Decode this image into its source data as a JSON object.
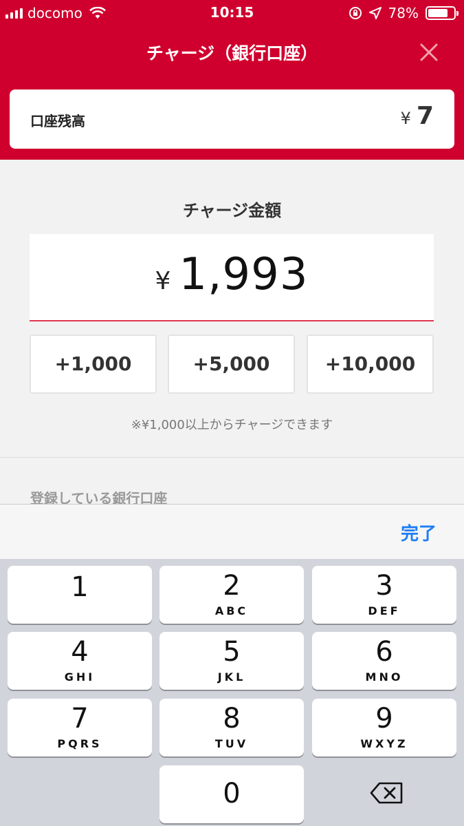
{
  "status_bar": {
    "carrier": "docomo",
    "time": "10:15",
    "battery": "78%",
    "battery_level": 0.78
  },
  "header": {
    "title": "チャージ（銀行口座）",
    "close_icon": "close-icon"
  },
  "balance": {
    "label": "口座残高",
    "currency": "¥",
    "value": "7"
  },
  "charge": {
    "title": "チャージ金額",
    "currency": "¥",
    "amount": "1,993",
    "quick_buttons": [
      "+1,000",
      "+5,000",
      "+10,000"
    ],
    "note": "※¥1,000以上からチャージできます"
  },
  "bank_section": {
    "label": "登録している銀行口座"
  },
  "keyboard": {
    "done_label": "完了",
    "accent_color": "#1e7ef5",
    "keys": [
      {
        "digit": "1",
        "letters": ""
      },
      {
        "digit": "2",
        "letters": "ABC"
      },
      {
        "digit": "3",
        "letters": "DEF"
      },
      {
        "digit": "4",
        "letters": "GHI"
      },
      {
        "digit": "5",
        "letters": "JKL"
      },
      {
        "digit": "6",
        "letters": "MNO"
      },
      {
        "digit": "7",
        "letters": "PQRS"
      },
      {
        "digit": "8",
        "letters": "TUV"
      },
      {
        "digit": "9",
        "letters": "WXYZ"
      },
      {
        "digit": "0",
        "letters": ""
      }
    ],
    "delete_icon": "backspace-icon"
  },
  "colors": {
    "brand": "#d0002e",
    "amount_underline": "#e0364f"
  }
}
